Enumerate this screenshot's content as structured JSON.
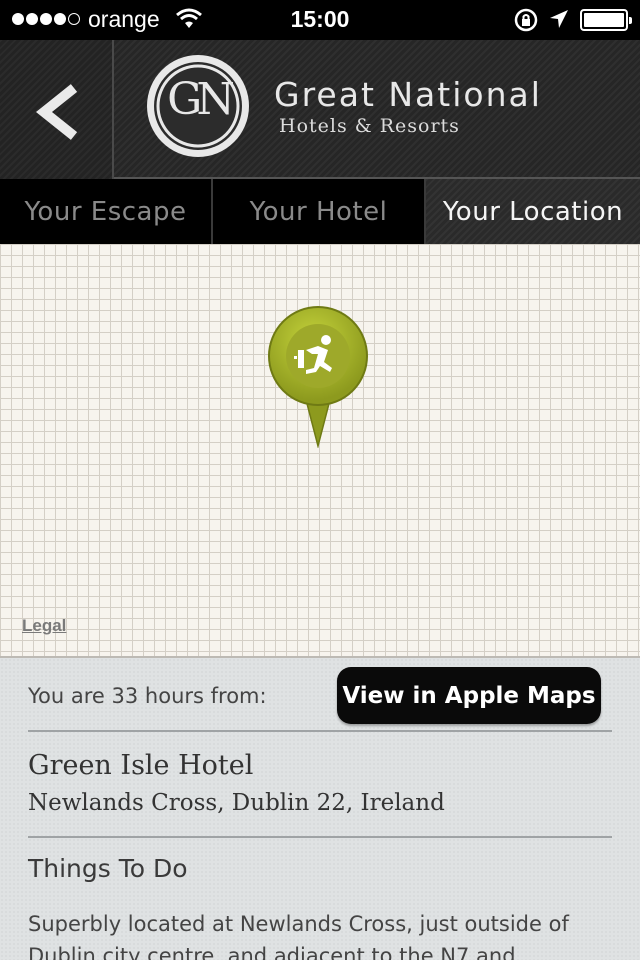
{
  "status_bar": {
    "carrier": "orange",
    "time": "15:00",
    "signal_bars": 4,
    "signal_total": 5,
    "battery_level": 1.0,
    "icons": [
      "wifi-icon",
      "rotation-lock-icon",
      "location-arrow-icon",
      "battery-icon"
    ]
  },
  "header": {
    "back_icon": "chevron-left-icon",
    "logo_text": "GN",
    "brand_title": "Great National",
    "brand_subtitle": "Hotels & Resorts"
  },
  "tabs": [
    {
      "label": "Your Escape",
      "selected": false
    },
    {
      "label": "Your Hotel",
      "selected": false
    },
    {
      "label": "Your Location",
      "selected": true
    }
  ],
  "map": {
    "pin_icon": "running-man-pin-icon",
    "pin_color": "#a9b82a",
    "legal_label": "Legal"
  },
  "info": {
    "distance_text": "You are 33 hours from:",
    "maps_button_label": "View in Apple Maps",
    "hotel_name": "Green Isle Hotel",
    "hotel_address": "Newlands Cross, Dublin 22, Ireland",
    "section_title": "Things To Do",
    "description": "Superbly located at Newlands Cross, just outside of Dublin city centre, and adjacent to the N7 and"
  },
  "colors": {
    "header_bg": "#2a2a2a",
    "tab_active_text": "#f5f5f5",
    "tab_inactive_text": "#8a8a8a",
    "map_bg": "#f7f4ee",
    "panel_bg": "#dfe2e3",
    "button_bg": "#0a0a0a"
  }
}
